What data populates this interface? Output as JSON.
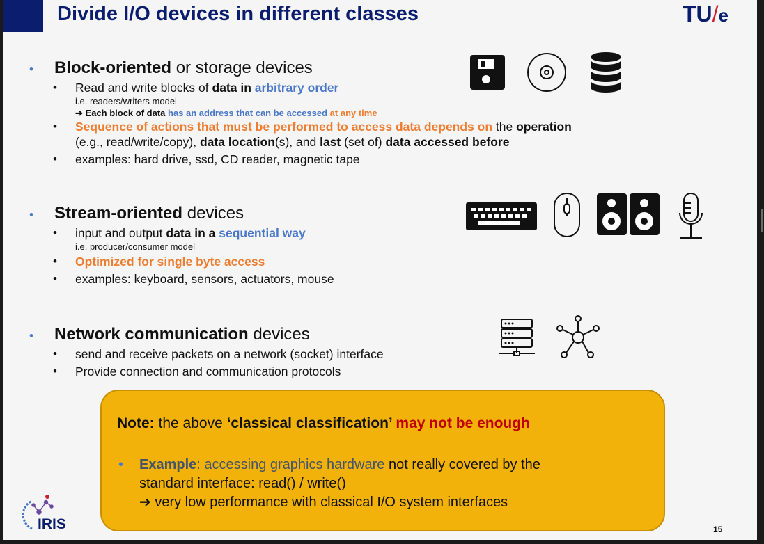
{
  "title": "Divide I/O devices in different classes",
  "logo": {
    "tu": "TU",
    "slash": "/",
    "e": "e"
  },
  "sections": {
    "block": {
      "heading_bold": "Block-oriented",
      "heading_rest": " or storage devices",
      "b1_pre": "Read and write blocks of ",
      "b1_bold": "data in ",
      "b1_blue": "arbitrary order",
      "b1_note": "i.e. readers/writers model",
      "b1_arrow": "➔",
      "b1_sub_bold": " Each block of data ",
      "b1_sub_blue1": "has an address that can be accessed ",
      "b1_sub_orange": "at any time",
      "b2_orange": "Sequence of actions that must be performed to access data depends on",
      "b2_rest1": " the ",
      "b2_bold1": "operation",
      "b2_line2_a": "(e.g., read/write/copy), ",
      "b2_bold2": "data location",
      "b2_line2_b": "(s), and ",
      "b2_bold3": "last",
      "b2_line2_c": " (set of) ",
      "b2_bold4": "data accessed before",
      "b3": "examples: hard drive, ssd, CD reader, magnetic tape"
    },
    "stream": {
      "heading_bold": "Stream-oriented",
      "heading_rest": " devices",
      "b1_pre": "input and output ",
      "b1_bold": "data in a ",
      "b1_blue": "sequential way",
      "b1_note": "i.e. producer/consumer model",
      "b2_orange": "Optimized for single byte access",
      "b3": "examples: keyboard, sensors, actuators, mouse"
    },
    "network": {
      "heading_bold": "Network communication",
      "heading_rest": " devices",
      "b1": "send and receive packets on a network (socket) interface",
      "b2": "Provide connection and communication protocols"
    }
  },
  "bullet": "•",
  "note": {
    "label": "Note:",
    "mid": " the above ",
    "quote": "‘classical classification’",
    "red": " may not be enough",
    "ex_bold": "Example",
    "ex_gray": ": accessing graphics hardware",
    "ex_rest": " not really covered by the",
    "ex_line2": "standard interface: read() / write()",
    "ex_arrow": "➔",
    "ex_line3": " very low performance with classical I/O system interfaces"
  },
  "iris_logo": "IRIS",
  "page_number": "15",
  "icons": [
    "floppy-disk-icon",
    "cd-icon",
    "database-icon",
    "keyboard-icon",
    "mouse-icon",
    "speakers-icon",
    "microphone-icon",
    "server-icon",
    "network-hub-icon"
  ],
  "colors": {
    "navy": "#0b1d6e",
    "blue": "#4a78c9",
    "orange": "#ed7d31",
    "red": "#c00000",
    "note_bg": "#f2b20a"
  }
}
